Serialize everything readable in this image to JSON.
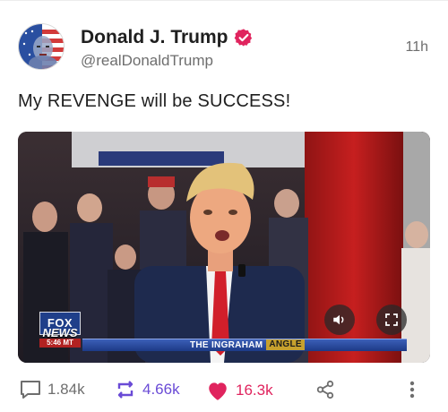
{
  "post": {
    "author": {
      "display_name": "Donald J. Trump",
      "handle": "@realDonaldTrump",
      "verified": true,
      "avatar_icon": "user-avatar"
    },
    "timestamp": "11h",
    "text": "My REVENGE will be SUCCESS!",
    "media": {
      "type": "video",
      "channel_logo": {
        "fox": "FOX",
        "news": "NEWS",
        "time": "5:46 MT"
      },
      "lower_third": {
        "part1": "THE INGRAHAM",
        "part2": "ANGLE"
      },
      "controls": {
        "volume_icon": "volume-icon",
        "fullscreen_icon": "fullscreen-icon"
      }
    },
    "actions": {
      "replies": "1.84k",
      "reposts": "4.66k",
      "likes": "16.3k"
    }
  },
  "colors": {
    "verified": "#e0245e",
    "repost": "#6a4bd6",
    "like": "#e0245e",
    "muted": "#6e6e6e"
  }
}
